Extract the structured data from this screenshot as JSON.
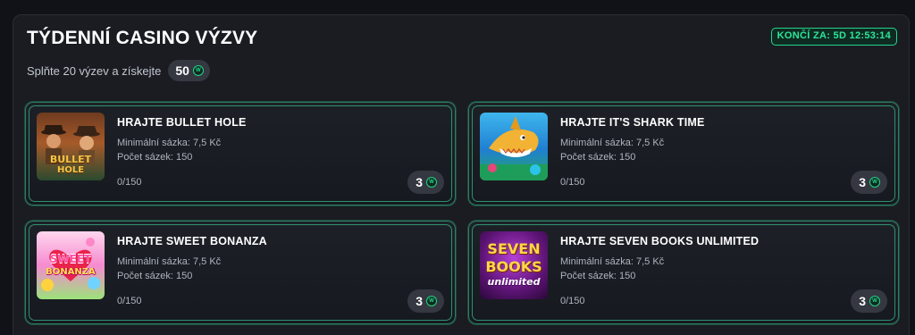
{
  "header": {
    "title": "TÝDENNÍ CASINO VÝZVY",
    "timer": "KONČÍ ZA: 5D 12:53:14",
    "subtitle": "Splňte 20 výzev a získejte",
    "reward_total": "50"
  },
  "colors": {
    "accent": "#24d68c",
    "panel": "#1a1c22",
    "pill": "#353841"
  },
  "coin_icon": "coin-icon",
  "challenges": [
    {
      "title": "HRAJTE BULLET HOLE",
      "min_bet": "Minimální sázka: 7,5 Kč",
      "bet_count": "Počet sázek: 150",
      "progress": "0/150",
      "reward": "3",
      "thumb_logo_1": "BULLET",
      "thumb_logo_2": "HOLE"
    },
    {
      "title": "HRAJTE IT'S SHARK TIME",
      "min_bet": "Minimální sázka: 7,5 Kč",
      "bet_count": "Počet sázek: 150",
      "progress": "0/150",
      "reward": "3"
    },
    {
      "title": "HRAJTE SWEET BONANZA",
      "min_bet": "Minimální sázka: 7,5 Kč",
      "bet_count": "Počet sázek: 150",
      "progress": "0/150",
      "reward": "3",
      "thumb_logo_1": "SWEET",
      "thumb_logo_2": "BONANZA"
    },
    {
      "title": "HRAJTE SEVEN BOOKS UNLIMITED",
      "min_bet": "Minimální sázka: 7,5 Kč",
      "bet_count": "Počet sázek: 150",
      "progress": "0/150",
      "reward": "3",
      "thumb_logo_1": "SEVEN",
      "thumb_logo_2": "BOOKS",
      "thumb_logo_3": "unlimited"
    }
  ]
}
